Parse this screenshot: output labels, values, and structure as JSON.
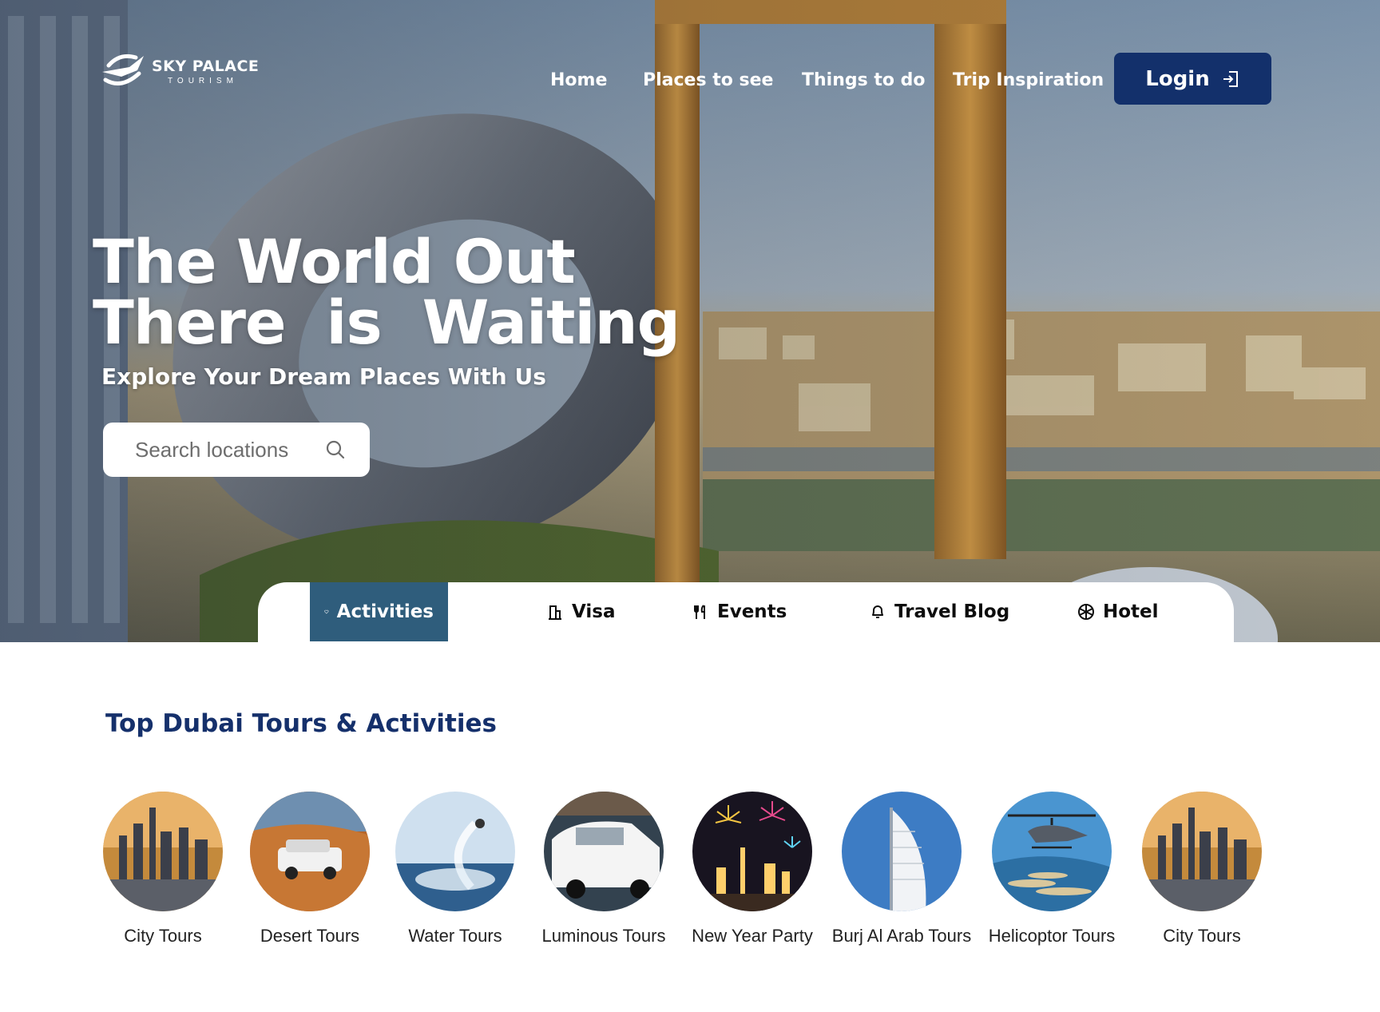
{
  "brand": {
    "name": "SKY PALACE",
    "tagline": "TOURISM"
  },
  "nav": {
    "items": [
      "Home",
      "Places to see",
      "Things to do",
      "Trip Inspiration"
    ],
    "login_label": "Login"
  },
  "hero": {
    "headline_line1": "The World Out",
    "headline_line2": "There  is  Waiting",
    "subheadline": "Explore Your Dream Places With Us",
    "search_placeholder": "Search locations"
  },
  "tabs": [
    {
      "label": "Activities",
      "icon": "heart-icon",
      "active": true
    },
    {
      "label": "Visa",
      "icon": "building-icon",
      "active": false
    },
    {
      "label": "Events",
      "icon": "utensils-icon",
      "active": false
    },
    {
      "label": "Travel Blog",
      "icon": "bell-icon",
      "active": false
    },
    {
      "label": "Hotel",
      "icon": "wheel-icon",
      "active": false
    }
  ],
  "section": {
    "title": "Top Dubai Tours & Activities",
    "tours": [
      {
        "label": "City Tours",
        "image": "city-skyline"
      },
      {
        "label": "Desert Tours",
        "image": "desert-suv"
      },
      {
        "label": "Water Tours",
        "image": "flyboard-water"
      },
      {
        "label": "Luminous Tours",
        "image": "white-limousine"
      },
      {
        "label": "New Year Party",
        "image": "fireworks"
      },
      {
        "label": "Burj Al Arab Tours",
        "image": "burj-al-arab"
      },
      {
        "label": "Helicoptor  Tours",
        "image": "helicopter-palm"
      },
      {
        "label": "City Tours",
        "image": "city-skyline"
      }
    ]
  },
  "colors": {
    "primary_navy": "#13306b",
    "active_tab": "#2f5d7c",
    "title_blue": "#15306b"
  }
}
